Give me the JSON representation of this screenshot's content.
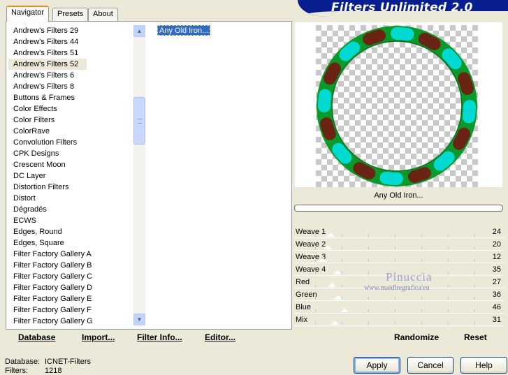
{
  "app": {
    "title": "Filters Unlimited 2.0"
  },
  "tabs": [
    {
      "label": "Navigator",
      "active": true
    },
    {
      "label": "Presets",
      "active": false
    },
    {
      "label": "About",
      "active": false
    }
  ],
  "categories": {
    "items": [
      "Andrew's Filters 29",
      "Andrew's Filters 44",
      "Andrew's Filters 51",
      "Andrew's Filters 52",
      "Andrew's Filters 6",
      "Andrew's Filters 8",
      "Buttons & Frames",
      "Color Effects",
      "Color Filters",
      "ColorRave",
      "Convolution Filters",
      "CPK Designs",
      "Crescent Moon",
      "DC Layer",
      "Distortion Filters",
      "Distort",
      "Dégradés",
      "ECWS",
      "Edges, Round",
      "Edges, Square",
      "Filter Factory Gallery A",
      "Filter Factory Gallery B",
      "Filter Factory Gallery C",
      "Filter Factory Gallery D",
      "Filter Factory Gallery E",
      "Filter Factory Gallery F",
      "Filter Factory Gallery G"
    ],
    "selected": "Andrew's Filters 52",
    "scroll_up_icon": "triangle-up",
    "scroll_down_icon": "triangle-down"
  },
  "filters": {
    "items": [
      "Any Old Iron..."
    ],
    "selected": "Any Old Iron..."
  },
  "left_buttons": {
    "database": "Database",
    "import": "Import...",
    "filter_info": "Filter Info...",
    "editor": "Editor..."
  },
  "preview": {
    "filter_name": "Any Old Iron...",
    "progress": 0,
    "ring_colors": [
      "#0a9a2a",
      "#00e5f0",
      "#7a0f0f"
    ]
  },
  "params": [
    {
      "label": "Weave 1",
      "value": "24",
      "level": 0.094
    },
    {
      "label": "Weave 2",
      "value": "20",
      "level": 0.078
    },
    {
      "label": "Weave 3",
      "value": "12",
      "level": 0.047
    },
    {
      "label": "Weave 4",
      "value": "35",
      "level": 0.137
    },
    {
      "label": "Red",
      "value": "27",
      "level": 0.106
    },
    {
      "label": "Green",
      "value": "36",
      "level": 0.141
    },
    {
      "label": "Blue",
      "value": "46",
      "level": 0.18
    },
    {
      "label": "Mix",
      "value": "31",
      "level": 0.122
    }
  ],
  "watermark": {
    "line1": "Pinuccia",
    "line2": "www.maidiregrafica.eu"
  },
  "right_buttons": {
    "randomize": "Randomize",
    "reset": "Reset"
  },
  "status": {
    "database_label": "Database:",
    "database_value": "ICNET-Filters",
    "filters_label": "Filters:",
    "filters_value": "1218"
  },
  "dialog_buttons": {
    "apply": "Apply",
    "cancel": "Cancel",
    "help": "Help"
  },
  "colors": {
    "banner": "#0a1f8f",
    "selection": "#316ac5",
    "tab_highlight": "#e68b2c",
    "window": "#ece9d8"
  }
}
